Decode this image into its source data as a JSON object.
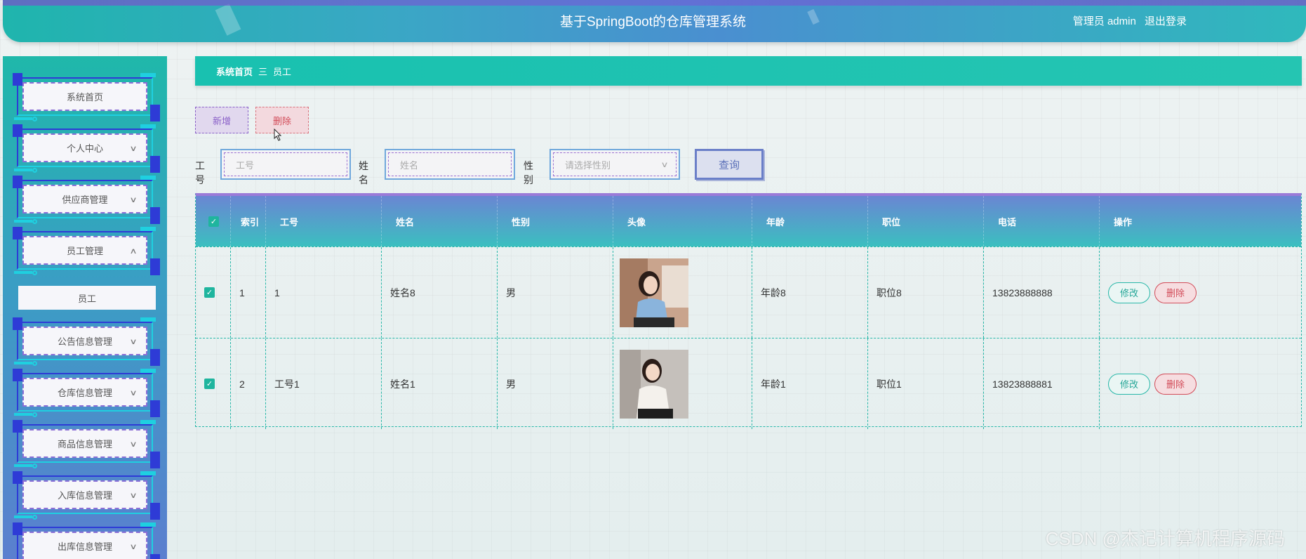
{
  "header": {
    "title": "基于SpringBoot的仓库管理系统",
    "user": "管理员 admin",
    "logout": "退出登录"
  },
  "sidebar": {
    "items": [
      {
        "label": "系统首页",
        "has_chevron": false
      },
      {
        "label": "个人中心",
        "has_chevron": true
      },
      {
        "label": "供应商管理",
        "has_chevron": true
      },
      {
        "label": "员工管理",
        "has_chevron": true,
        "expanded": true
      },
      {
        "label": "公告信息管理",
        "has_chevron": true
      },
      {
        "label": "仓库信息管理",
        "has_chevron": true
      },
      {
        "label": "商品信息管理",
        "has_chevron": true
      },
      {
        "label": "入库信息管理",
        "has_chevron": true
      },
      {
        "label": "出库信息管理",
        "has_chevron": true
      }
    ],
    "submenu": {
      "label": "员工"
    }
  },
  "breadcrumb": {
    "home": "系统首页",
    "separator": "三",
    "current": "员工"
  },
  "toolbar": {
    "add": "新增",
    "delete": "删除"
  },
  "search": {
    "emp_no_label": "工号",
    "emp_no_placeholder": "工号",
    "name_label": "姓名",
    "name_placeholder": "姓名",
    "gender_label": "性别",
    "gender_placeholder": "请选择性别",
    "query": "查询"
  },
  "table": {
    "headers": [
      "索引",
      "工号",
      "姓名",
      "性别",
      "头像",
      "年龄",
      "职位",
      "电话",
      "操作"
    ],
    "rows": [
      {
        "index": "1",
        "emp_no": "1",
        "name": "姓名8",
        "gender": "男",
        "age": "年龄8",
        "position": "职位8",
        "phone": "13823888888",
        "edit": "修改",
        "delete": "删除",
        "checked": true
      },
      {
        "index": "2",
        "emp_no": "工号1",
        "name": "姓名1",
        "gender": "男",
        "age": "年龄1",
        "position": "职位1",
        "phone": "13823888881",
        "edit": "修改",
        "delete": "删除",
        "checked": true
      }
    ]
  },
  "watermark": "CSDN @杰记计算机程序源码",
  "colors": {
    "accent": "#1fb5ad",
    "primary_purple": "#8a60c8",
    "danger": "#d24b58"
  }
}
